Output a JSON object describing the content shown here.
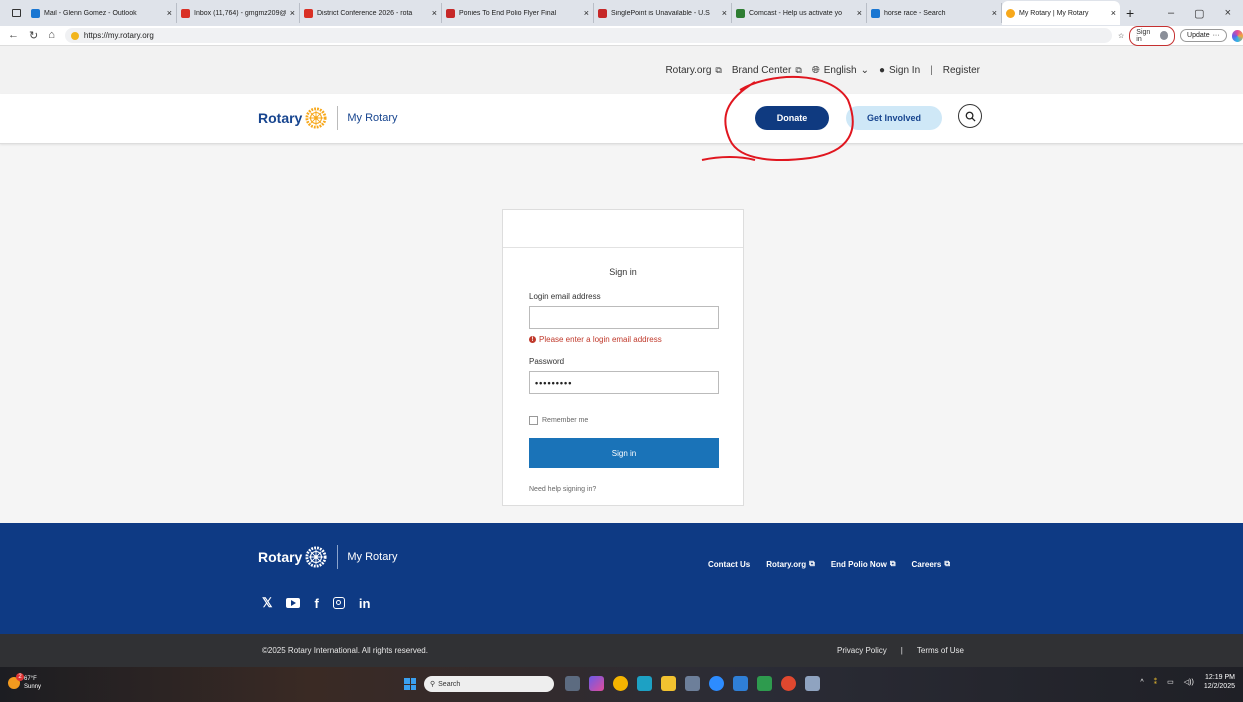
{
  "browser": {
    "tabs": [
      {
        "title": "Mail - Glenn Gomez - Outlook",
        "color": "#1976d2"
      },
      {
        "title": "Inbox (11,764) - gmgmz209@",
        "color": "#d93025"
      },
      {
        "title": "District Conference 2026 - rota",
        "color": "#d93025"
      },
      {
        "title": "Ponies To End Polio Flyer Final",
        "color": "#c62828"
      },
      {
        "title": "SinglePoint is Unavailable - U.S",
        "color": "#c62828"
      },
      {
        "title": "Comcast - Help us activate yo",
        "color": "#2e7d32"
      },
      {
        "title": "horse race - Search",
        "color": "#1976d2"
      },
      {
        "title": "My Rotary | My Rotary",
        "color": "#f7a81b"
      }
    ],
    "url": "https://my.rotary.org",
    "signin_pill": "Sign in",
    "update_pill": "Update"
  },
  "utility": {
    "rotary_org": "Rotary.org",
    "brand_center": "Brand Center",
    "language": "English",
    "sign_in": "Sign In",
    "separator": "|",
    "register": "Register"
  },
  "header": {
    "logo_word": "Rotary",
    "logo_sub": "My Rotary",
    "donate": "Donate",
    "get_involved": "Get Involved"
  },
  "signin": {
    "title": "Sign in",
    "email_label": "Login email address",
    "email_value": "",
    "error": "Please enter a login email address",
    "password_label": "Password",
    "password_value": "•••••••••",
    "remember": "Remember me",
    "button": "Sign in",
    "help": "Need help signing in?"
  },
  "footer": {
    "logo_word": "Rotary",
    "logo_sub": "My Rotary",
    "links": [
      "Contact Us",
      "Rotary.org",
      "End Polio Now",
      "Careers"
    ],
    "social": [
      "X",
      "YouTube",
      "f",
      "Instagram",
      "in"
    ],
    "copyright": "©2025 Rotary International. All rights reserved.",
    "privacy": "Privacy Policy",
    "divider": "|",
    "terms": "Terms of Use"
  },
  "taskbar": {
    "temp": "67°F",
    "condition": "Sunny",
    "badge": "2",
    "search": "Search",
    "time": "12:19 PM",
    "date": "12/2/2025"
  },
  "colors": {
    "rotary_blue": "#17458f",
    "footer_blue": "#0e3a84",
    "button_blue": "#1a73b8",
    "rotary_gold": "#f7a81b",
    "error_red": "#c0392b"
  }
}
